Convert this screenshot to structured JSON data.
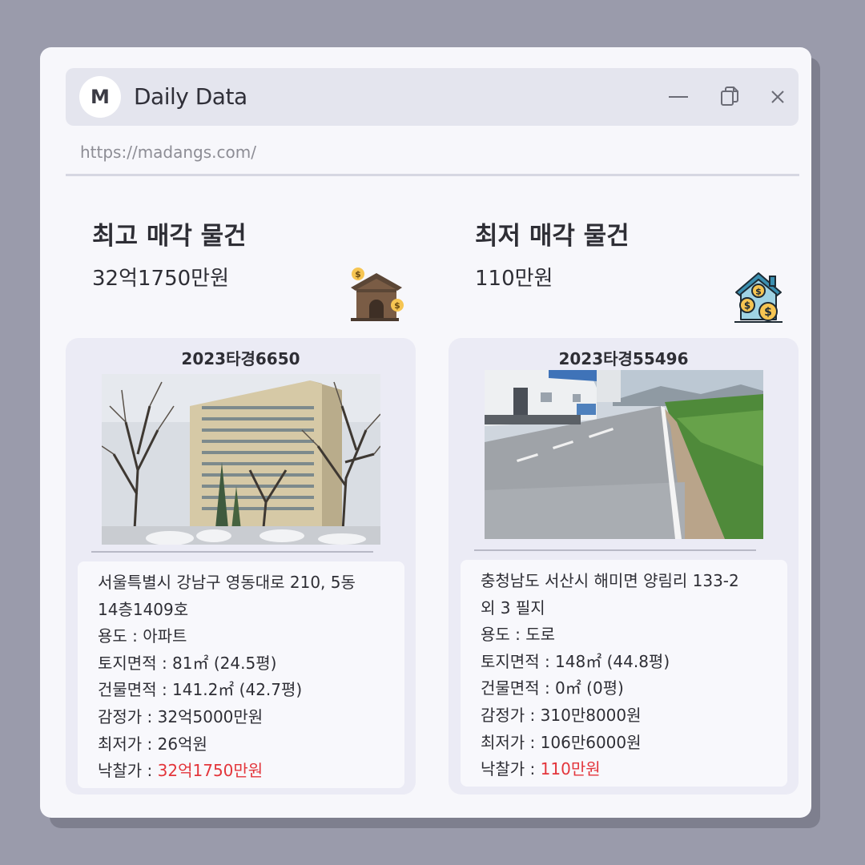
{
  "app": {
    "avatar_letter": "M",
    "title": "Daily Data",
    "url": "https://madangs.com/"
  },
  "highest": {
    "heading": "최고 매각 물건",
    "price": "32억1750만원",
    "icon": "house-money-icon",
    "case_no": "2023타경6650",
    "photo": "apartment-winter-photo",
    "address_line1": "서울특별시 강남구 영동대로 210, 5동",
    "address_line2": "14층1409호",
    "usage": "용도 : 아파트",
    "land_area": "토지면적 : 81㎡ (24.5평)",
    "building_area": "건물면적 : 141.2㎡ (42.7평)",
    "appraisal": "감정가 : 32억5000만원",
    "minimum": "최저가 : 26억원",
    "sold_label": "낙찰가 : ",
    "sold_value": "32억1750만원"
  },
  "lowest": {
    "heading": "최저 매각 물건",
    "price": "110만원",
    "icon": "house-coins-icon",
    "case_no": "2023타경55496",
    "photo": "rural-road-photo",
    "address_line1": "충청남도 서산시 해미면 양림리 133-2",
    "address_line2": "외 3 필지",
    "usage": "용도 : 도로",
    "land_area": "토지면적 : 148㎡ (44.8평)",
    "building_area": "건물면적 : 0㎡ (0평)",
    "appraisal": "감정가 : 310만8000원",
    "minimum": "최저가 : 106만6000원",
    "sold_label": "낙찰가 : ",
    "sold_value": "110만원"
  },
  "colors": {
    "background": "#9a9bab",
    "window": "#f7f7fb",
    "titlebar": "#e4e5ee",
    "card": "#ebebf5",
    "sold_price": "#e3353b"
  }
}
